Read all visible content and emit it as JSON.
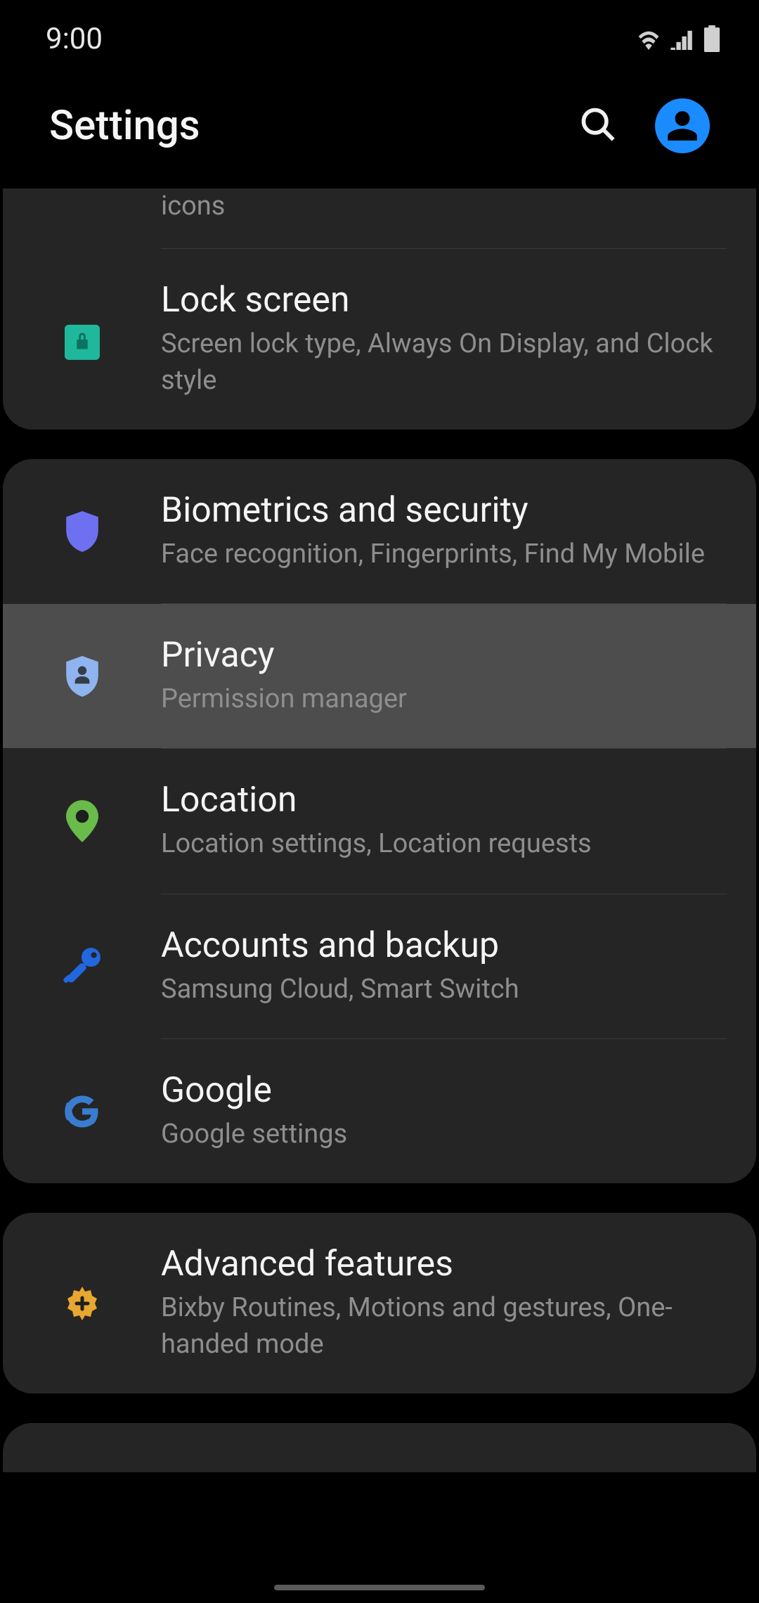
{
  "status": {
    "time": "9:00"
  },
  "header": {
    "title": "Settings"
  },
  "partialTop": {
    "subtitle": "icons"
  },
  "groups": [
    {
      "rows": [
        {
          "name": "lockscreen",
          "title": "Lock screen",
          "subtitle": "Screen lock type, Always On Display, and Clock style",
          "iconColor": "#1fb89c",
          "highlighted": false
        }
      ]
    },
    {
      "rows": [
        {
          "name": "biometrics",
          "title": "Biometrics and security",
          "subtitle": "Face recognition, Fingerprints, Find My Mobile",
          "iconColor": "#6e70f2",
          "highlighted": false
        },
        {
          "name": "privacy",
          "title": "Privacy",
          "subtitle": "Permission manager",
          "iconColor": "#8fb4ef",
          "highlighted": true
        },
        {
          "name": "location",
          "title": "Location",
          "subtitle": "Location settings, Location requests",
          "iconColor": "#6abb4a",
          "highlighted": false
        },
        {
          "name": "accounts",
          "title": "Accounts and backup",
          "subtitle": "Samsung Cloud, Smart Switch",
          "iconColor": "#2267e0",
          "highlighted": false
        },
        {
          "name": "google",
          "title": "Google",
          "subtitle": "Google settings",
          "iconColor": "#3a7cd0",
          "highlighted": false
        }
      ]
    },
    {
      "rows": [
        {
          "name": "advanced",
          "title": "Advanced features",
          "subtitle": "Bixby Routines, Motions and gestures, One-handed mode",
          "iconColor": "#e8a730",
          "highlighted": false
        }
      ]
    }
  ]
}
